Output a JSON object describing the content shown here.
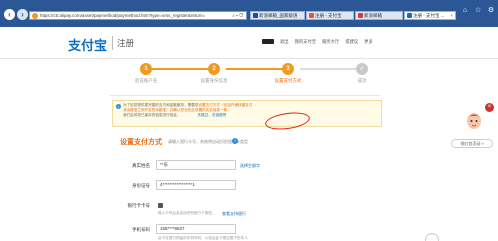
{
  "browser": {
    "url": "https://ctr.alipay.com/asset/paymethod/paymethod.htm?type=sms_register&return=",
    "tabs": [
      {
        "label": "新浪邮箱_国家级语",
        "color": "#1a4fa0"
      },
      {
        "label": "注册 - 支付宝",
        "color": "#e8562e"
      },
      {
        "label": "新浪邮箱",
        "color": "#d33f2b"
      },
      {
        "label": "注册 - 支付宝 ...",
        "color": "#0b70c4"
      }
    ]
  },
  "header": {
    "logo": "支付宝",
    "subtitle": "注册",
    "nav": [
      "退出",
      "我的支付宝",
      "服务大厅",
      "提建议",
      "更多"
    ]
  },
  "steps": [
    {
      "num": "1",
      "label": "验证账户名",
      "state": "done"
    },
    {
      "num": "2",
      "label": "设置身份信息",
      "state": "done"
    },
    {
      "num": "3",
      "label": "设置支付方式",
      "state": "current"
    },
    {
      "num": "✓",
      "label": "成功",
      "state": "todo"
    }
  ],
  "notice": {
    "line1a": "为了给您提供更完善的支付和金融服务，需要您",
    "line1b": "设置支付方式",
    "line1c": "（包括开通快捷支付…",
    "line2": "或余额宝之前开发的余额宝）并确认您也在此设置的实名信息一致，",
    "line3a": "我们会将您已保存的信息进行验证。",
    "line3b": "先跳过，去逛逛吧"
  },
  "form": {
    "title": "设置支付方式",
    "subtitle": "请输入银行卡号，系统将自动识别银行卡类型",
    "name_label": "真实姓名",
    "name_value": "**东",
    "name_link": "选择生僻字",
    "id_label": "身份证号",
    "id_value": "4*****************1",
    "card_label": "银行卡卡号",
    "card_hint": "输入卡号后会自动识别银行卡类型，",
    "card_link": "查看支持银行",
    "phone_label": "手机号码",
    "phone_value": "158****8627",
    "phone_hint": "此卡在银行预留的手机号码，以验证此卡是否属于您本人"
  },
  "side": {
    "close": "×",
    "button": "领红包活动 »"
  }
}
